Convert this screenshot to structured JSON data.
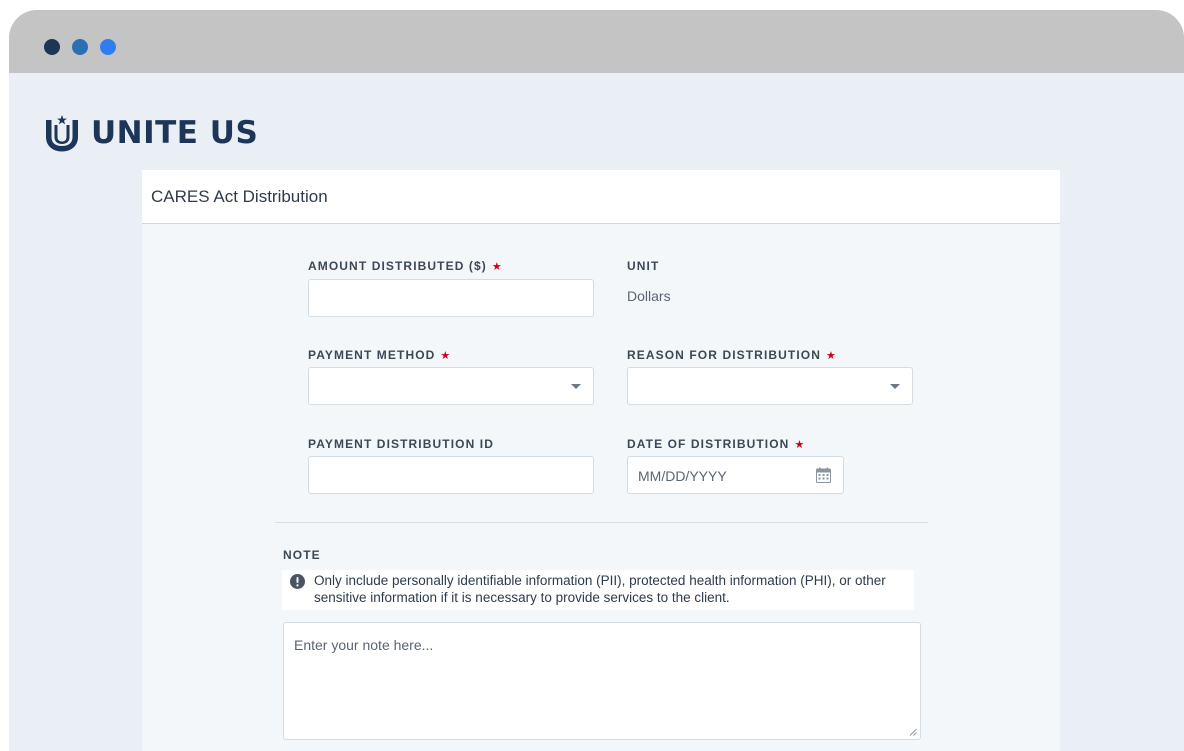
{
  "window": {
    "controls": [
      "close",
      "minimize",
      "maximize"
    ]
  },
  "brand": {
    "name": "UNITE US",
    "logo_icon": "unite-us-logo-icon",
    "color": "#1d3557"
  },
  "form": {
    "title": "CARES Act Distribution",
    "required_marker": "★",
    "fields": {
      "amount": {
        "label": "AMOUNT DISTRIBUTED ($)",
        "value": "",
        "required": true
      },
      "unit": {
        "label": "UNIT",
        "value": "Dollars"
      },
      "payment_method": {
        "label": "PAYMENT METHOD",
        "value": "",
        "required": true
      },
      "reason": {
        "label": "REASON FOR DISTRIBUTION",
        "value": "",
        "required": true
      },
      "payment_id": {
        "label": "PAYMENT DISTRIBUTION ID",
        "value": ""
      },
      "date": {
        "label": "DATE OF DISTRIBUTION",
        "placeholder": "MM/DD/YYYY",
        "required": true,
        "icon": "calendar-icon"
      }
    },
    "note": {
      "label": "NOTE",
      "warning_icon": "info-icon",
      "warning": "Only include personally identifiable information (PII), protected health information (PHI), or other sensitive information if it is necessary to provide services to the client.",
      "placeholder": "Enter your note here..."
    }
  },
  "colors": {
    "required": "#d0021b",
    "window_bg": "#e9eff5",
    "titlebar": "#c4c4c4"
  }
}
